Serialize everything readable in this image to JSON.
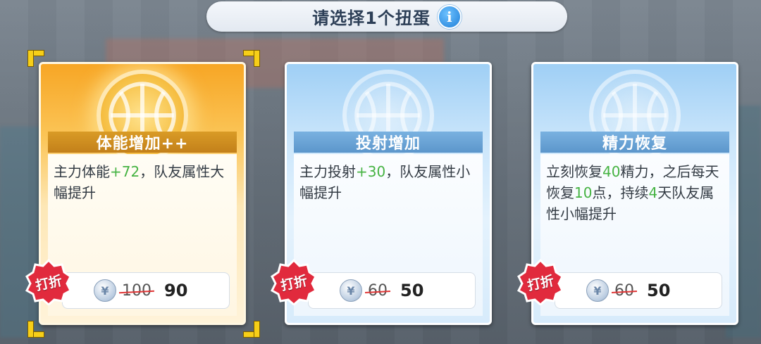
{
  "title": {
    "text": "请选择1个扭蛋",
    "info_icon": "info-icon"
  },
  "colors": {
    "accent_green": "#46b343",
    "discount_red": "#e12a3d",
    "selection_yellow": "#f7cf18"
  },
  "cards": [
    {
      "name": "体能增加++",
      "desc_lead": "主力体能",
      "desc_bonus": "+72",
      "desc_tail": "，队友属性大幅提升",
      "discount_label": "打折",
      "old_price": "100",
      "new_price": "90",
      "selected": true
    },
    {
      "name": "投射增加",
      "desc_lead": "主力投射",
      "desc_bonus": "+30",
      "desc_tail": "，队友属性小幅提升",
      "discount_label": "打折",
      "old_price": "60",
      "new_price": "50",
      "selected": false
    },
    {
      "name": "精力恢复",
      "desc_parts": [
        "立刻恢复",
        "40",
        "精力，之后每天恢复",
        "10",
        "点，持续",
        "4",
        "天队友属性小幅提升"
      ],
      "discount_label": "打折",
      "old_price": "60",
      "new_price": "50",
      "selected": false
    }
  ],
  "currency_symbol": "¥"
}
